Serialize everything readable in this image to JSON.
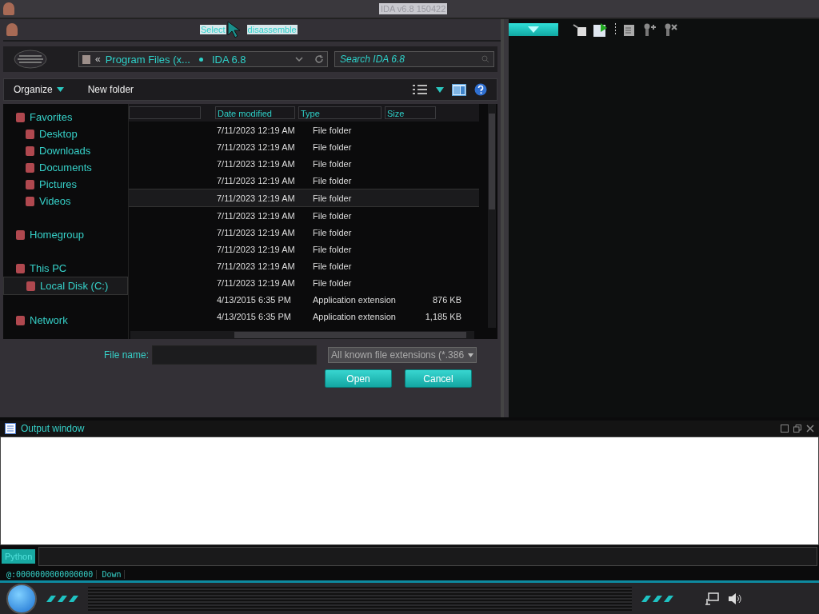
{
  "top_bar": {
    "title": "IDA v6.8 150422"
  },
  "dialog": {
    "title_parts": [
      "Select",
      "disassemble"
    ],
    "breadcrumb": {
      "chevron": "«",
      "crumbs": [
        "Program Files (x...",
        "IDA 6.8"
      ]
    },
    "search": {
      "placeholder": "Search IDA 6.8"
    },
    "toolbar": {
      "organize": "Organize",
      "new_folder": "New folder"
    },
    "sidebar": [
      {
        "label": "Favorites",
        "selected": false,
        "children": [
          {
            "label": "Desktop",
            "selected": false
          },
          {
            "label": "Downloads",
            "selected": false
          },
          {
            "label": "Documents",
            "selected": false
          },
          {
            "label": "Pictures",
            "selected": false
          },
          {
            "label": "Videos",
            "selected": false
          }
        ]
      },
      {
        "label": "Homegroup",
        "selected": false
      },
      {
        "label": "This PC",
        "selected": false,
        "children": [
          {
            "label": "Local Disk (C:)",
            "selected": true
          }
        ]
      },
      {
        "label": "Network",
        "selected": false
      }
    ],
    "columns": [
      "Date modified",
      "Type",
      "Size"
    ],
    "rows": [
      {
        "date": "7/11/2023 12:19 AM",
        "type": "File folder",
        "selected": false
      },
      {
        "date": "7/11/2023 12:19 AM",
        "type": "File folder",
        "selected": false
      },
      {
        "date": "7/11/2023 12:19 AM",
        "type": "File folder",
        "selected": false
      },
      {
        "date": "7/11/2023 12:19 AM",
        "type": "File folder",
        "selected": false
      },
      {
        "date": "7/11/2023 12:19 AM",
        "type": "File folder",
        "selected": true
      },
      {
        "date": "7/11/2023 12:19 AM",
        "type": "File folder",
        "selected": false
      },
      {
        "date": "7/11/2023 12:19 AM",
        "type": "File folder",
        "selected": false
      },
      {
        "date": "7/11/2023 12:19 AM",
        "type": "File folder",
        "selected": false
      },
      {
        "date": "7/11/2023 12:19 AM",
        "type": "File folder",
        "selected": false
      },
      {
        "date": "7/11/2023 12:19 AM",
        "type": "File folder",
        "selected": false
      },
      {
        "date": "4/13/2015 6:35 PM",
        "type": "Application extension",
        "size": "876 KB",
        "selected": false
      },
      {
        "date": "4/13/2015 6:35 PM",
        "type": "Application extension",
        "size": "1,185 KB",
        "selected": false
      }
    ],
    "file_name": {
      "label": "File name:"
    },
    "file_type": "All known file extensions (*.386",
    "buttons": [
      "Open",
      "Cancel"
    ]
  },
  "output_window": {
    "title": "Output window"
  },
  "command_bar": {
    "language": "Python"
  },
  "status_bar": [
    "@:0000000000000000",
    "Down"
  ]
}
